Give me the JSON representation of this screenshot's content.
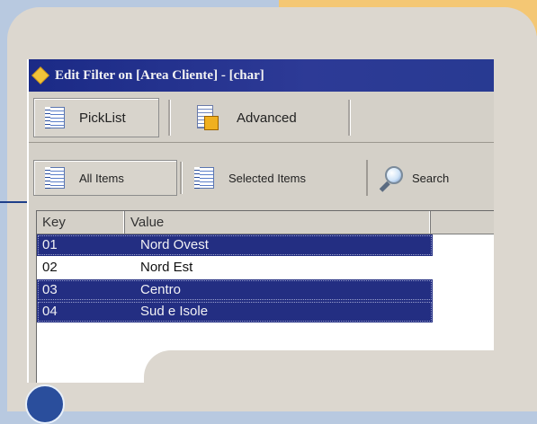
{
  "window": {
    "title": "Edit Filter on [Area Cliente] - [char]"
  },
  "toolbar": {
    "tabs": [
      {
        "label": "PickList",
        "icon": "list-icon"
      },
      {
        "label": "Advanced",
        "icon": "advanced-filter-icon"
      }
    ]
  },
  "subtabs": [
    {
      "label": "All Items",
      "icon": "list-icon"
    },
    {
      "label": "Selected Items",
      "icon": "list-icon"
    },
    {
      "label": "Search",
      "icon": "search-icon"
    }
  ],
  "grid": {
    "columns": [
      "Key",
      "Value"
    ],
    "rows": [
      {
        "key": "01",
        "value": "Nord Ovest",
        "selected": true
      },
      {
        "key": "02",
        "value": "Nord Est",
        "selected": false
      },
      {
        "key": "03",
        "value": "Centro",
        "selected": true
      },
      {
        "key": "04",
        "value": "Sud e Isole",
        "selected": true
      }
    ]
  },
  "colors": {
    "titlebar": "#1b2a86",
    "selection": "#232e82",
    "accent_diamond": "#f1c33a"
  }
}
